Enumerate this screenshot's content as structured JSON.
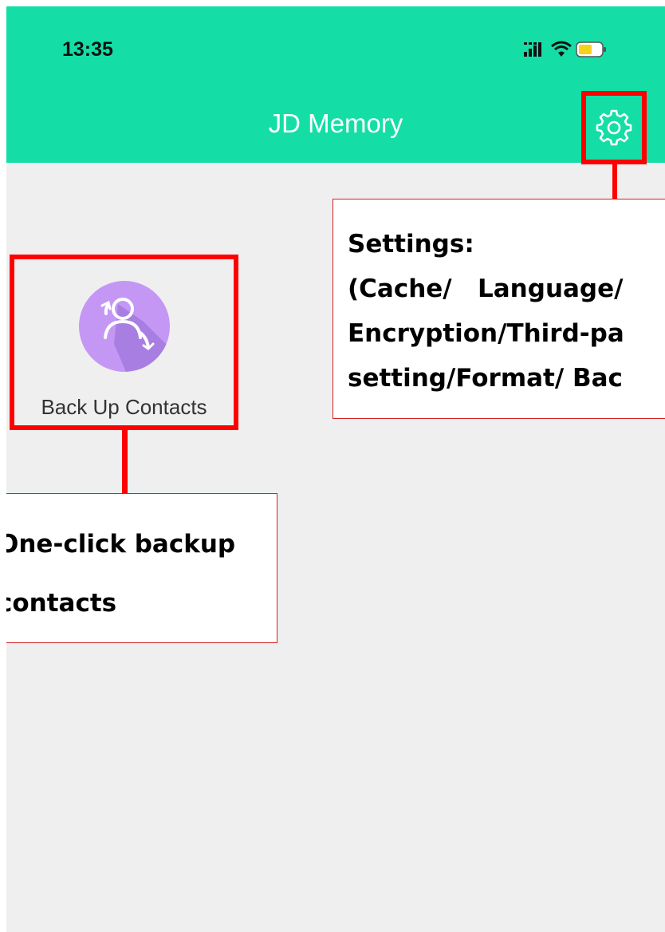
{
  "status_bar": {
    "time": "13:35",
    "icons": [
      "signal-icon",
      "wifi-icon",
      "battery-icon"
    ]
  },
  "header": {
    "title": "JD Memory",
    "settings_icon": "gear-icon",
    "background_color": "#14dea6"
  },
  "main": {
    "contacts_button": {
      "label": "Back Up Contacts",
      "icon": "contacts-sync-icon",
      "icon_color": "#c497f5"
    }
  },
  "annotations": {
    "highlight_color": "#ff0000",
    "settings_note": {
      "lines": [
        "Settings:",
        "(Cache/   Language/",
        "Encryption/Third-pa",
        "setting/Format/ Bac"
      ]
    },
    "backup_note": {
      "lines": [
        "One-click backup",
        "contacts"
      ]
    }
  }
}
